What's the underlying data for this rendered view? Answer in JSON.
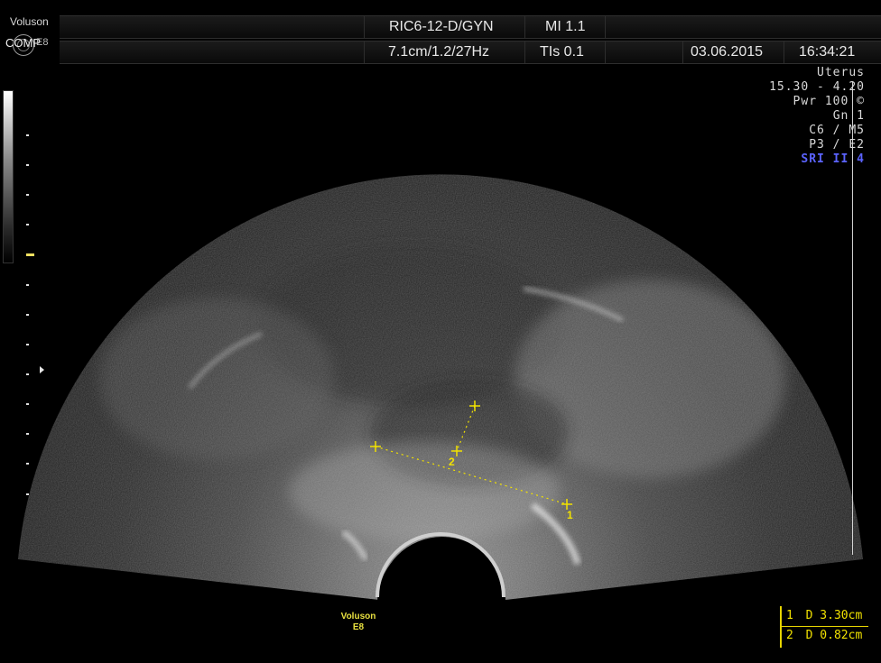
{
  "brand": {
    "name": "Voluson",
    "comp_label": "COMP",
    "model": "E8"
  },
  "header": {
    "probe_preset": "RIC6-12-D/GYN",
    "mi": "MI  1.1",
    "depth_freq": "7.1cm/1.2/27Hz",
    "tis": "TIs  0.1",
    "date": "03.06.2015",
    "time": "16:34:21"
  },
  "params": {
    "preset": "Uterus",
    "frequency": "15.30 - 4.20",
    "power": "Pwr 100 ©",
    "gain": "Gn   1",
    "cm": "C6 / M5",
    "pe": "P3 / E2",
    "sri": "SRI II 4"
  },
  "measurements": [
    {
      "index": "1",
      "label": "D 3.30cm"
    },
    {
      "index": "2",
      "label": "D 0.82cm"
    }
  ],
  "caliper_labels": {
    "m1": "1",
    "m2": "2"
  },
  "probe_label": {
    "brand": "Voluson",
    "model": "E8"
  },
  "colors": {
    "caliper": "#f2e200",
    "sri": "#5b63ff",
    "background": "#000000"
  }
}
